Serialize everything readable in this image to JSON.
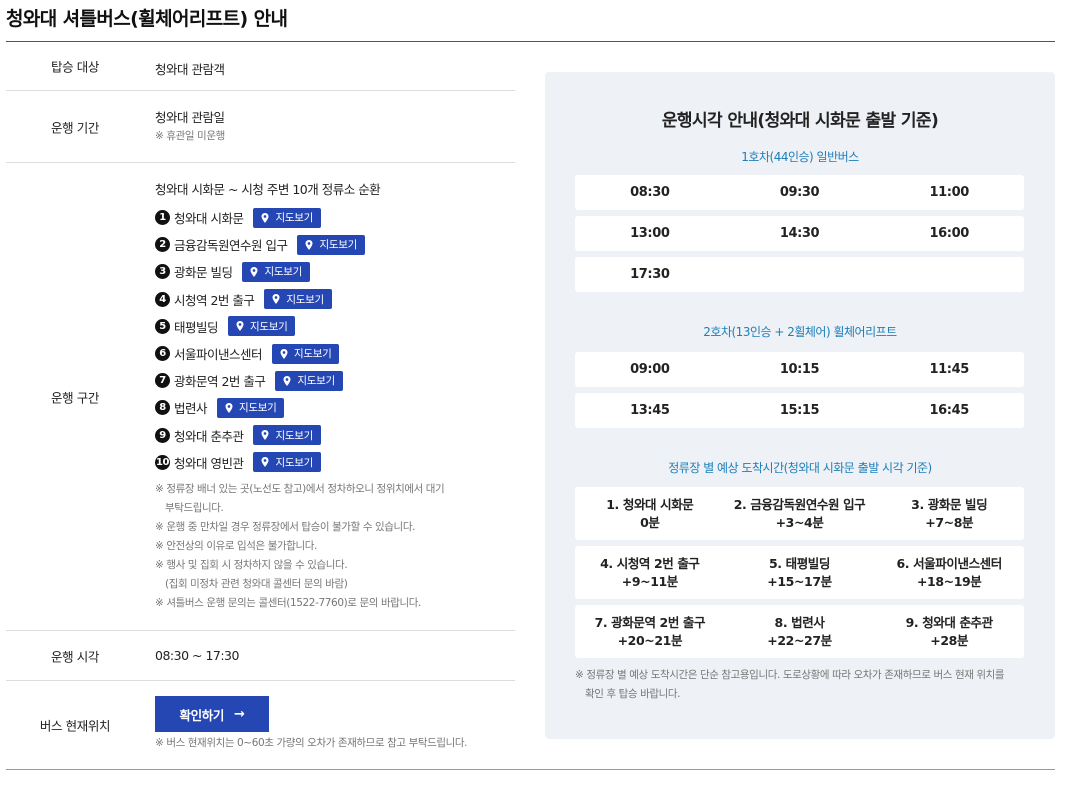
{
  "page_title": "청와대 셔틀버스(휠체어리프트) 안내",
  "info": {
    "target": {
      "label": "탑승 대상",
      "value": "청와대 관람객"
    },
    "period": {
      "label": "운행 기간",
      "value": "청와대 관람일",
      "note": "※ 휴관일 미운행"
    },
    "route": {
      "label": "운행 구간",
      "summary": "청와대 시화문 ~ 시청 주변 10개 정류소 순환",
      "map_label": "지도보기",
      "stops": [
        {
          "num": "1",
          "name": "청와대 시화문"
        },
        {
          "num": "2",
          "name": "금융감독원연수원 입구"
        },
        {
          "num": "3",
          "name": "광화문 빌딩"
        },
        {
          "num": "4",
          "name": "시청역 2번 출구"
        },
        {
          "num": "5",
          "name": "태평빌딩"
        },
        {
          "num": "6",
          "name": "서울파이낸스센터"
        },
        {
          "num": "7",
          "name": "광화문역 2번 출구"
        },
        {
          "num": "8",
          "name": "법련사"
        },
        {
          "num": "9",
          "name": "청와대 춘추관"
        },
        {
          "num": "10",
          "name": "청와대 영빈관"
        }
      ],
      "notes": [
        "※ 정류장 배너 있는 곳(노선도 참고)에서 정차하오니 정위치에서 대기",
        "부탁드립니다.",
        "※ 운행 중 만차일 경우 정류장에서 탑승이 불가할 수 있습니다.",
        "※ 안전상의 이유로 입석은 불가합니다.",
        "※ 행사 및 집회 시 정차하지 않을 수 있습니다.",
        "(집회 미정차 관련 청와대 콜센터 문의 바람)",
        "※ 셔틀버스 운행 문의는 콜센터(1522-7760)로 문의 바랍니다."
      ]
    },
    "hours": {
      "label": "운행 시각",
      "value": "08:30 ~ 17:30"
    },
    "location": {
      "label": "버스 현재위치",
      "button": "확인하기",
      "arrow": "→",
      "note": "※ 버스 현재위치는 0~60초 가량의 오차가 존재하므로 참고 부탁드립니다."
    }
  },
  "schedule": {
    "title": "운행시각 안내(청와대 시화문 출발 기준)",
    "bus1": {
      "label": "1호차(44인승) 일반버스",
      "rows": [
        [
          "08:30",
          "09:30",
          "11:00"
        ],
        [
          "13:00",
          "14:30",
          "16:00"
        ],
        [
          "17:30",
          "",
          ""
        ]
      ]
    },
    "bus2": {
      "label": "2호차(13인승 + 2휠체어) 휠체어리프트",
      "rows": [
        [
          "09:00",
          "10:15",
          "11:45"
        ],
        [
          "13:45",
          "15:15",
          "16:45"
        ]
      ]
    },
    "eta": {
      "label": "정류장 별 예상 도착시간(청와대 시화문 출발 시각 기준)",
      "rows": [
        [
          {
            "stop": "1. 청와대 시화문",
            "time": "0분"
          },
          {
            "stop": "2. 금융감독원연수원 입구",
            "time": "+3~4분"
          },
          {
            "stop": "3. 광화문 빌딩",
            "time": "+7~8분"
          }
        ],
        [
          {
            "stop": "4. 시청역 2번 출구",
            "time": "+9~11분"
          },
          {
            "stop": "5. 태평빌딩",
            "time": "+15~17분"
          },
          {
            "stop": "6. 서울파이낸스센터",
            "time": "+18~19분"
          }
        ],
        [
          {
            "stop": "7. 광화문역 2번 출구",
            "time": "+20~21분"
          },
          {
            "stop": "8. 법련사",
            "time": "+22~27분"
          },
          {
            "stop": "9. 청와대 춘추관",
            "time": "+28분"
          }
        ]
      ]
    },
    "note_line1": "※ 정류장 별 예상 도착시간은 단순 참고용입니다. 도로상황에 따라 오차가 존재하므로 버스 현재 위치를",
    "note_line2": "확인 후 탑승 바랍니다."
  },
  "colors": {
    "accent": "#2547b4",
    "sub_label": "#1e7fb8",
    "panel_bg": "#eef1f6"
  }
}
